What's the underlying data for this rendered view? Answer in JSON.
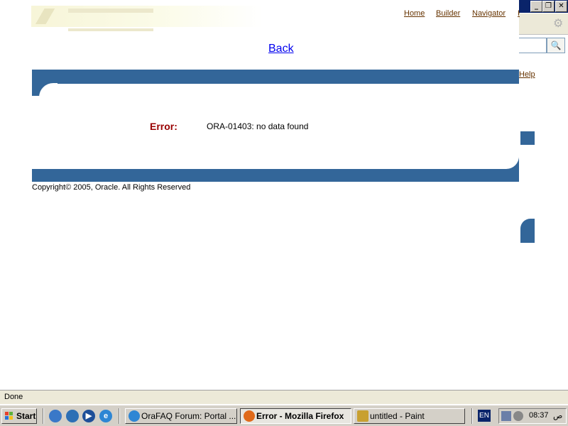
{
  "nav": {
    "home": "Home",
    "builder": "Builder",
    "navigator": "Navigator",
    "more": "H"
  },
  "page": {
    "back": "Back",
    "error_label": "Error:",
    "error_message": "ORA-01403: no data found",
    "copyright": "Copyright© 2005, Oracle. All Rights Reserved"
  },
  "bg_window": {
    "help_link": "Help",
    "buttons": {
      "minimize": "_",
      "maximize": "❐",
      "close": "✕"
    }
  },
  "status": {
    "text": "Done"
  },
  "taskbar": {
    "start": "Start",
    "tasks": [
      {
        "label": "OraFAQ Forum: Portal ...",
        "icon": "ie-icon"
      },
      {
        "label": "Error - Mozilla Firefox",
        "icon": "firefox-icon",
        "active": true
      },
      {
        "label": "untitled - Paint",
        "icon": "paint-icon"
      }
    ],
    "language": "EN",
    "clock": "08:37",
    "ampm": "ص"
  },
  "colors": {
    "band": "#336699",
    "error": "#990000",
    "link": "#663300",
    "back_link": "#0000ee"
  }
}
